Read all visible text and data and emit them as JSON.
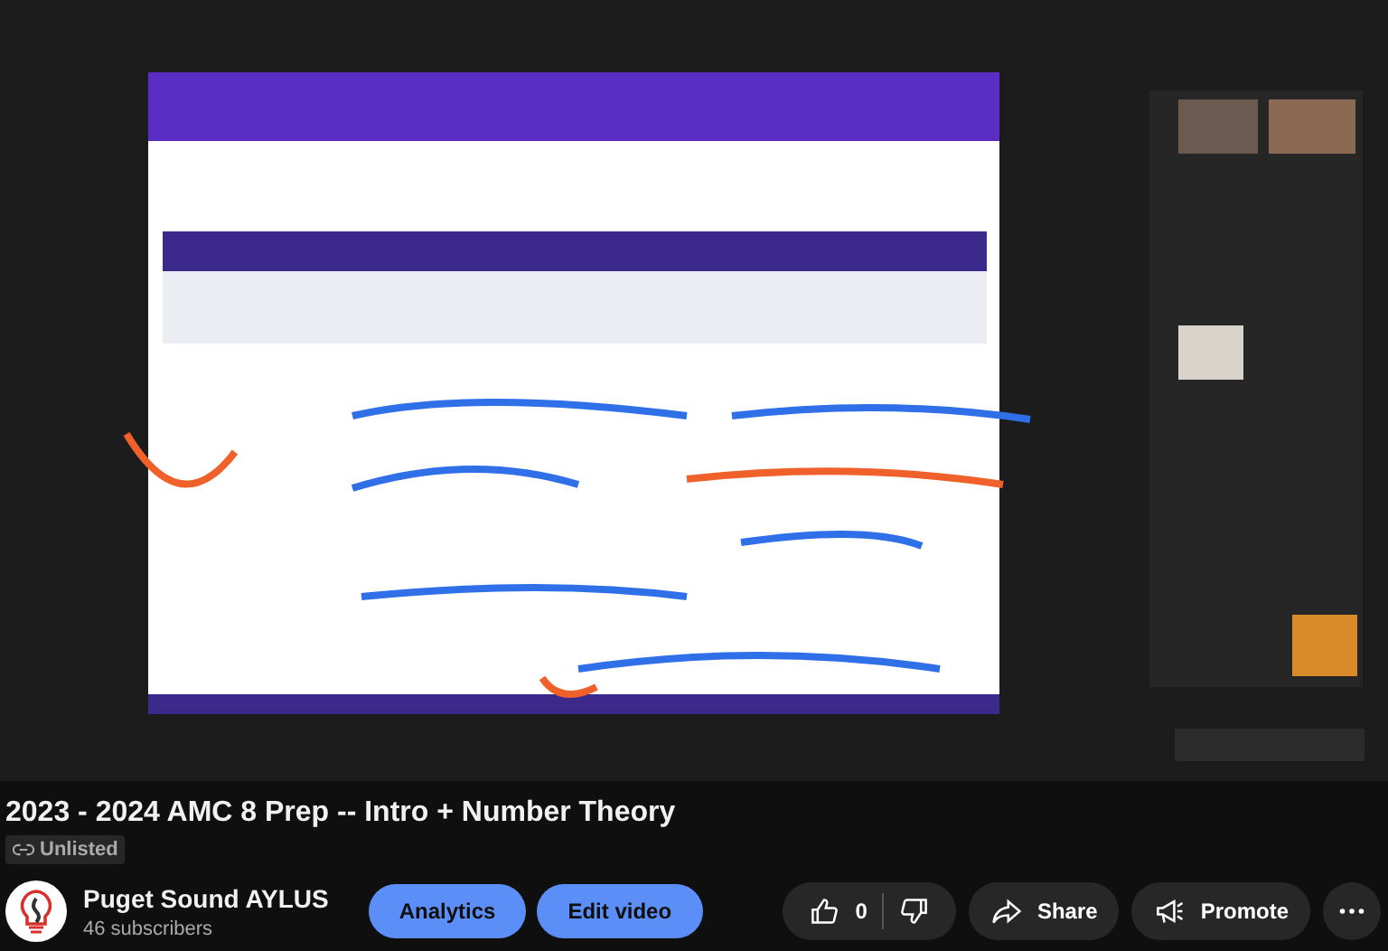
{
  "title": "2023 - 2024 AMC 8 Prep -- Intro + Number Theory",
  "visibility": {
    "label": "Unlisted"
  },
  "channel": {
    "name": "Puget Sound AYLUS",
    "subscribers": "46 subscribers"
  },
  "owner_buttons": [
    "Analytics",
    "Edit video"
  ],
  "likes": {
    "count": "0"
  },
  "actions": [
    {
      "label": "Share",
      "kind": "share"
    },
    {
      "label": "Promote",
      "kind": "promote"
    }
  ]
}
